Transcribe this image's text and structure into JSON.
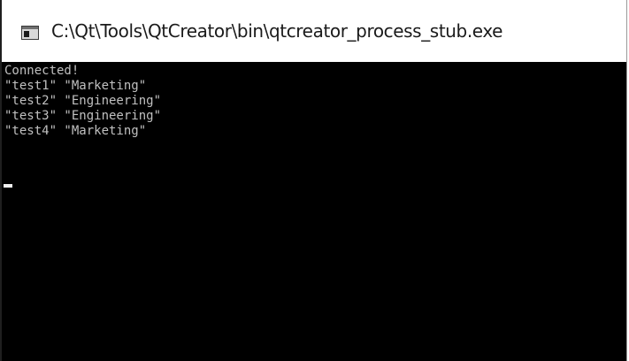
{
  "window": {
    "title": "C:\\Qt\\Tools\\QtCreator\\bin\\qtcreator_process_stub.exe",
    "icon": "console-window-icon"
  },
  "console": {
    "lines": [
      "Connected!",
      "\"test1\" \"Marketing\"",
      "\"test2\" \"Engineering\"",
      "\"test3\" \"Engineering\"",
      "\"test4\" \"Marketing\""
    ]
  },
  "colors": {
    "console_background": "#000000",
    "console_text": "#c0c0c0",
    "cursor": "#f0f0f0",
    "titlebar_background": "#ffffff",
    "title_text": "#1a1a1a"
  }
}
